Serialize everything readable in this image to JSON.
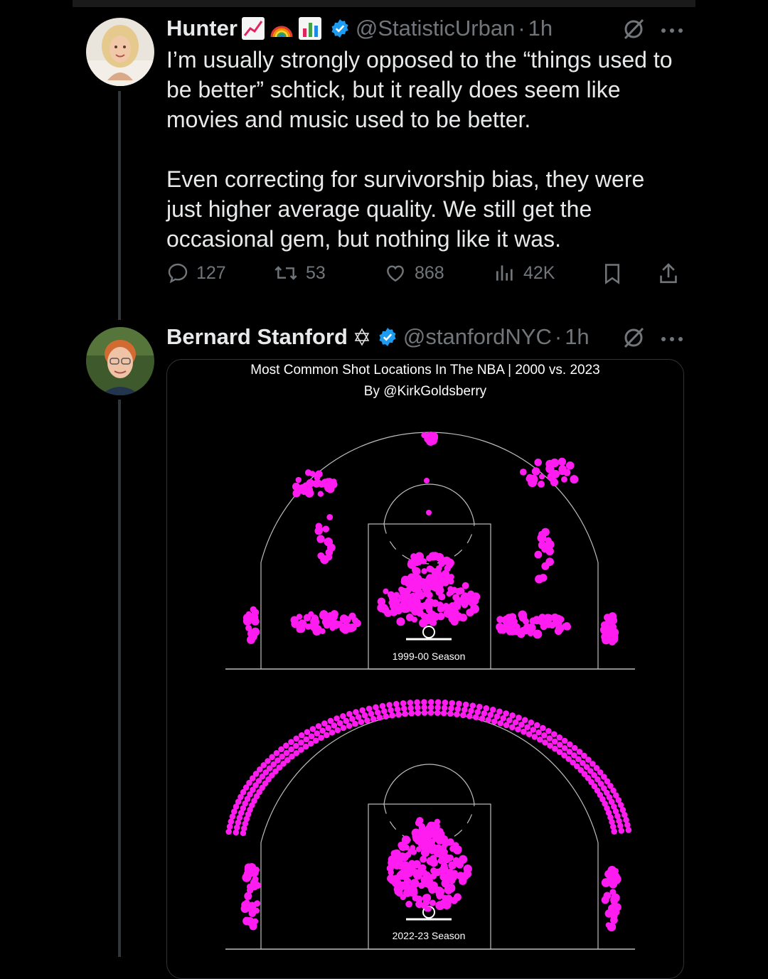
{
  "tweets": [
    {
      "name": "Hunter",
      "handle": "@StatisticUrban",
      "time": "1h",
      "text_p1": "I’m usually strongly opposed to the “things used to be better” schtick, but it really does seem like movies and music used to be better.",
      "text_p2": "Even correcting for survivorship bias, they were just higher average quality. We still get the occasional gem, but nothing like it was.",
      "replies": "127",
      "retweets": "53",
      "likes": "868",
      "views": "42K"
    },
    {
      "name": "Bernard Stanford",
      "handle": "@stanfordNYC",
      "time": "1h"
    }
  ],
  "chart_data": {
    "type": "heatmap",
    "title": "Most Common Shot Locations In The NBA | 2000 vs. 2023",
    "subtitle": "By @KirkGoldsberry",
    "panels": [
      {
        "label": "1999-00 Season",
        "hotspots": [
          "paint",
          "mid-range baseline",
          "mid-range elbows",
          "corner threes",
          "above-the-break threes (sparse)"
        ]
      },
      {
        "label": "2022-23 Season",
        "hotspots": [
          "restricted area / paint",
          "corner threes",
          "above-the-break threes (dense arc)"
        ]
      }
    ],
    "color": "#ff1cf0"
  },
  "colors": {
    "accent": "#1d9bf0",
    "text": "#e7e9ea",
    "muted": "#71767b",
    "hex": "#ff1cf0"
  },
  "icons": [
    "verified-badge-icon",
    "grok-icon",
    "more-icon",
    "reply-icon",
    "retweet-icon",
    "like-icon",
    "views-icon",
    "bookmark-icon",
    "share-icon",
    "star-of-david-icon"
  ]
}
